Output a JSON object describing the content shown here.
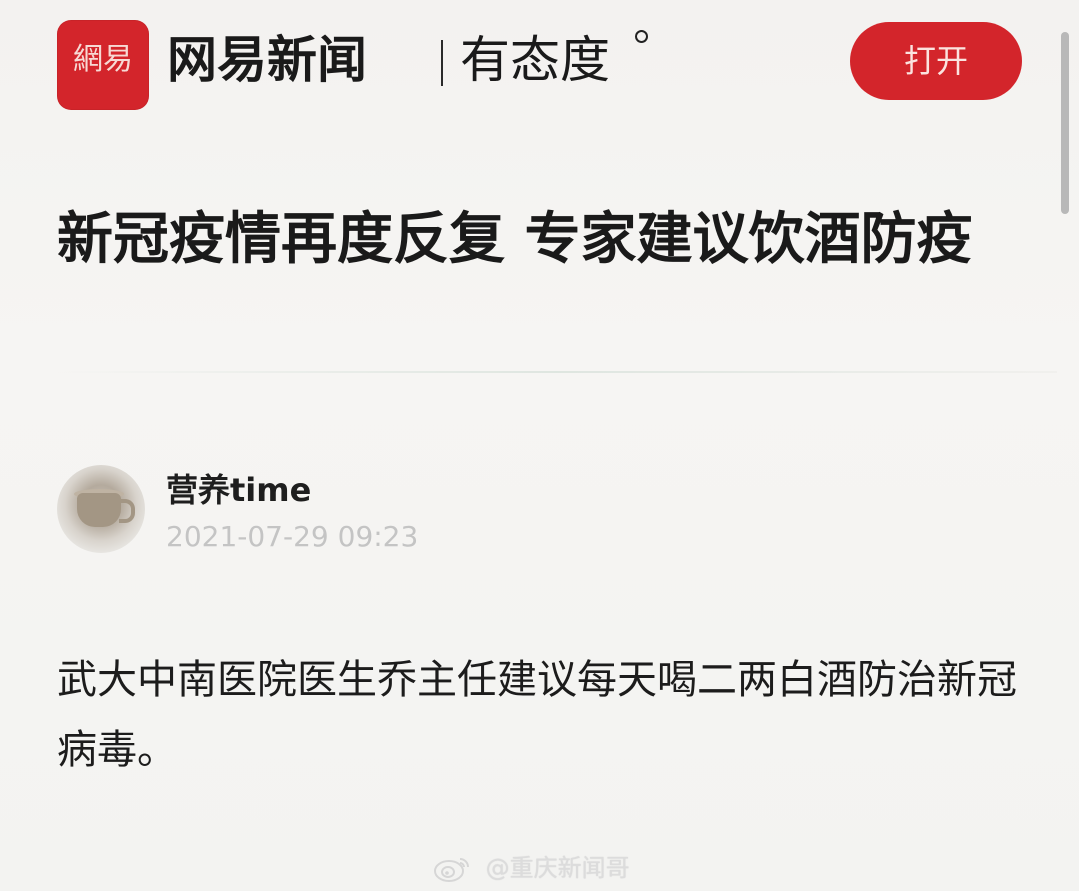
{
  "header": {
    "logo_text": "網易",
    "brand_name": "网易新闻",
    "slogan": "有态度",
    "open_button_label": "打开"
  },
  "article": {
    "title": "新冠疫情再度反复 专家建议饮酒防疫",
    "author": {
      "name": "营养time",
      "published_at": "2021-07-29 09:23"
    },
    "body": "武大中南医院医生乔主任建议每天喝二两白酒防治新冠病毒。"
  },
  "watermark": {
    "text": "@重庆新闻哥"
  },
  "colors": {
    "brand_red": "#d3252b",
    "timestamp_gray": "#c4c4c4"
  },
  "icons": {
    "watermark_icon": "weibo-icon"
  }
}
